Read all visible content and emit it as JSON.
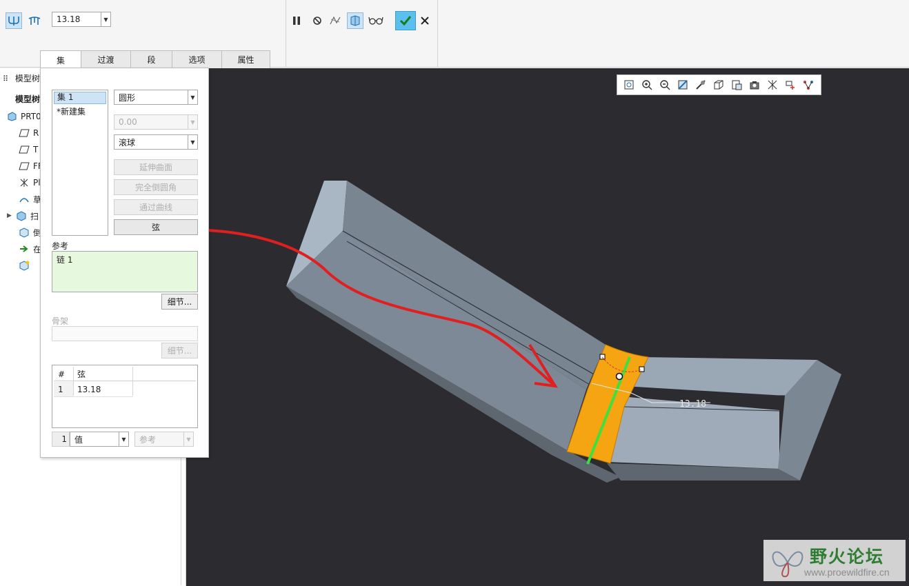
{
  "ribbon": {
    "radius_value": "13.18",
    "icons": [
      "round-set-icon",
      "round-transition-icon",
      "pause-icon",
      "no-preview-icon",
      "geometry-preview-icon",
      "verify-mode-icon",
      "glasses-preview-icon",
      "ok-check-icon",
      "cancel-x-icon"
    ],
    "accent_color": "#5bc0ee"
  },
  "tabs": [
    {
      "label": "集"
    },
    {
      "label": "过渡"
    },
    {
      "label": "段"
    },
    {
      "label": "选项"
    },
    {
      "label": "属性"
    }
  ],
  "model_tree": {
    "header": "模型树",
    "header_partial": "模型树",
    "sub_header": "模型树",
    "rows": [
      {
        "label": "PRT0",
        "icon": "part-icon"
      },
      {
        "label": "R",
        "icon": "datum-plane-icon"
      },
      {
        "label": "T",
        "icon": "datum-plane-icon"
      },
      {
        "label": "FF",
        "icon": "datum-plane-icon"
      },
      {
        "label": "Pl",
        "icon": "csys-icon"
      },
      {
        "label": "草",
        "icon": "sketch-icon"
      },
      {
        "label": "扫",
        "icon": "sweep-icon"
      },
      {
        "label": "倒",
        "icon": "round-icon"
      },
      {
        "label": "在",
        "icon": "insert-here-arrow-icon"
      },
      {
        "label": "",
        "icon": "round-new-icon"
      }
    ]
  },
  "panel": {
    "sets": [
      "集 1",
      "*新建集"
    ],
    "shape_select": "圆形",
    "value_select": "0.00",
    "method_select": "滚球",
    "buttons": {
      "extend_surfaces": "延伸曲面",
      "full_round": "完全倒圆角",
      "through_curve": "通过曲线",
      "chord": "弦"
    },
    "references_label": "参考",
    "references": [
      "链 1"
    ],
    "details_label": "细节...",
    "skeleton_label": "骨架",
    "skeleton_details_label": "细节...",
    "table": {
      "headers": [
        "#",
        "弦"
      ],
      "rows": [
        {
          "num": "1",
          "value": "13.18"
        }
      ]
    },
    "footer_index": "1",
    "footer_value_select": "值",
    "footer_ref_select": "参考"
  },
  "viewport": {
    "dimension_label": "13.18",
    "view_toolbar_icons": [
      "refit-icon",
      "zoom-in-icon",
      "zoom-out-icon",
      "repaint-icon",
      "display-style-icon",
      "saved-orientations-icon",
      "view-manager-icon",
      "perspective-icon",
      "datum-display-icon",
      "spin-center-icon",
      "annotation-display-icon"
    ],
    "highlight_color": "#f5a511",
    "chain_color": "#3ee03e",
    "annotation_color": "#e02020"
  },
  "watermark": {
    "title": "野火论坛",
    "url": "www.proewildfire.cn"
  }
}
